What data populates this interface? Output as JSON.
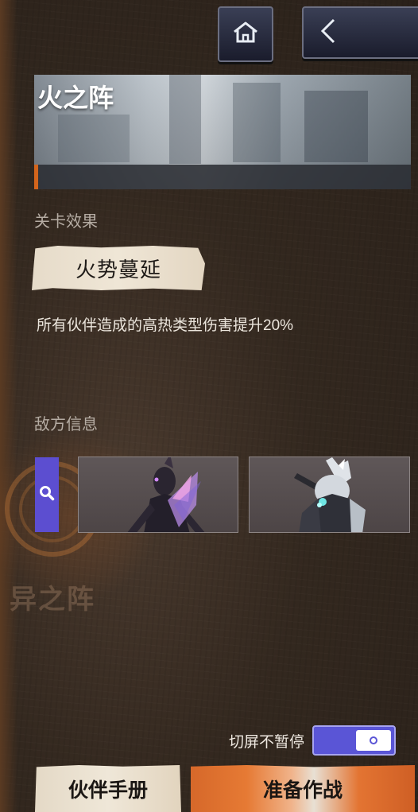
{
  "stage": {
    "title": "火之阵"
  },
  "effects": {
    "section_label": "关卡效果",
    "tag": "火势蔓延",
    "description": "所有伙伴造成的高热类型伤害提升20%"
  },
  "enemy": {
    "section_label": "敌方信息"
  },
  "background": {
    "watermark": "异之阵"
  },
  "settings": {
    "no_pause_label": "切屏不暂停",
    "no_pause_enabled": true
  },
  "buttons": {
    "partner_manual": "伙伴手册",
    "start_battle": "准备作战"
  },
  "icons": {
    "home": "home-icon",
    "back": "chevron-left-icon",
    "magnify": "search-icon"
  },
  "colors": {
    "accent_orange": "#d4651c",
    "toggle_purple": "#5a55d6",
    "magnify_purple": "#5c4ed0"
  }
}
